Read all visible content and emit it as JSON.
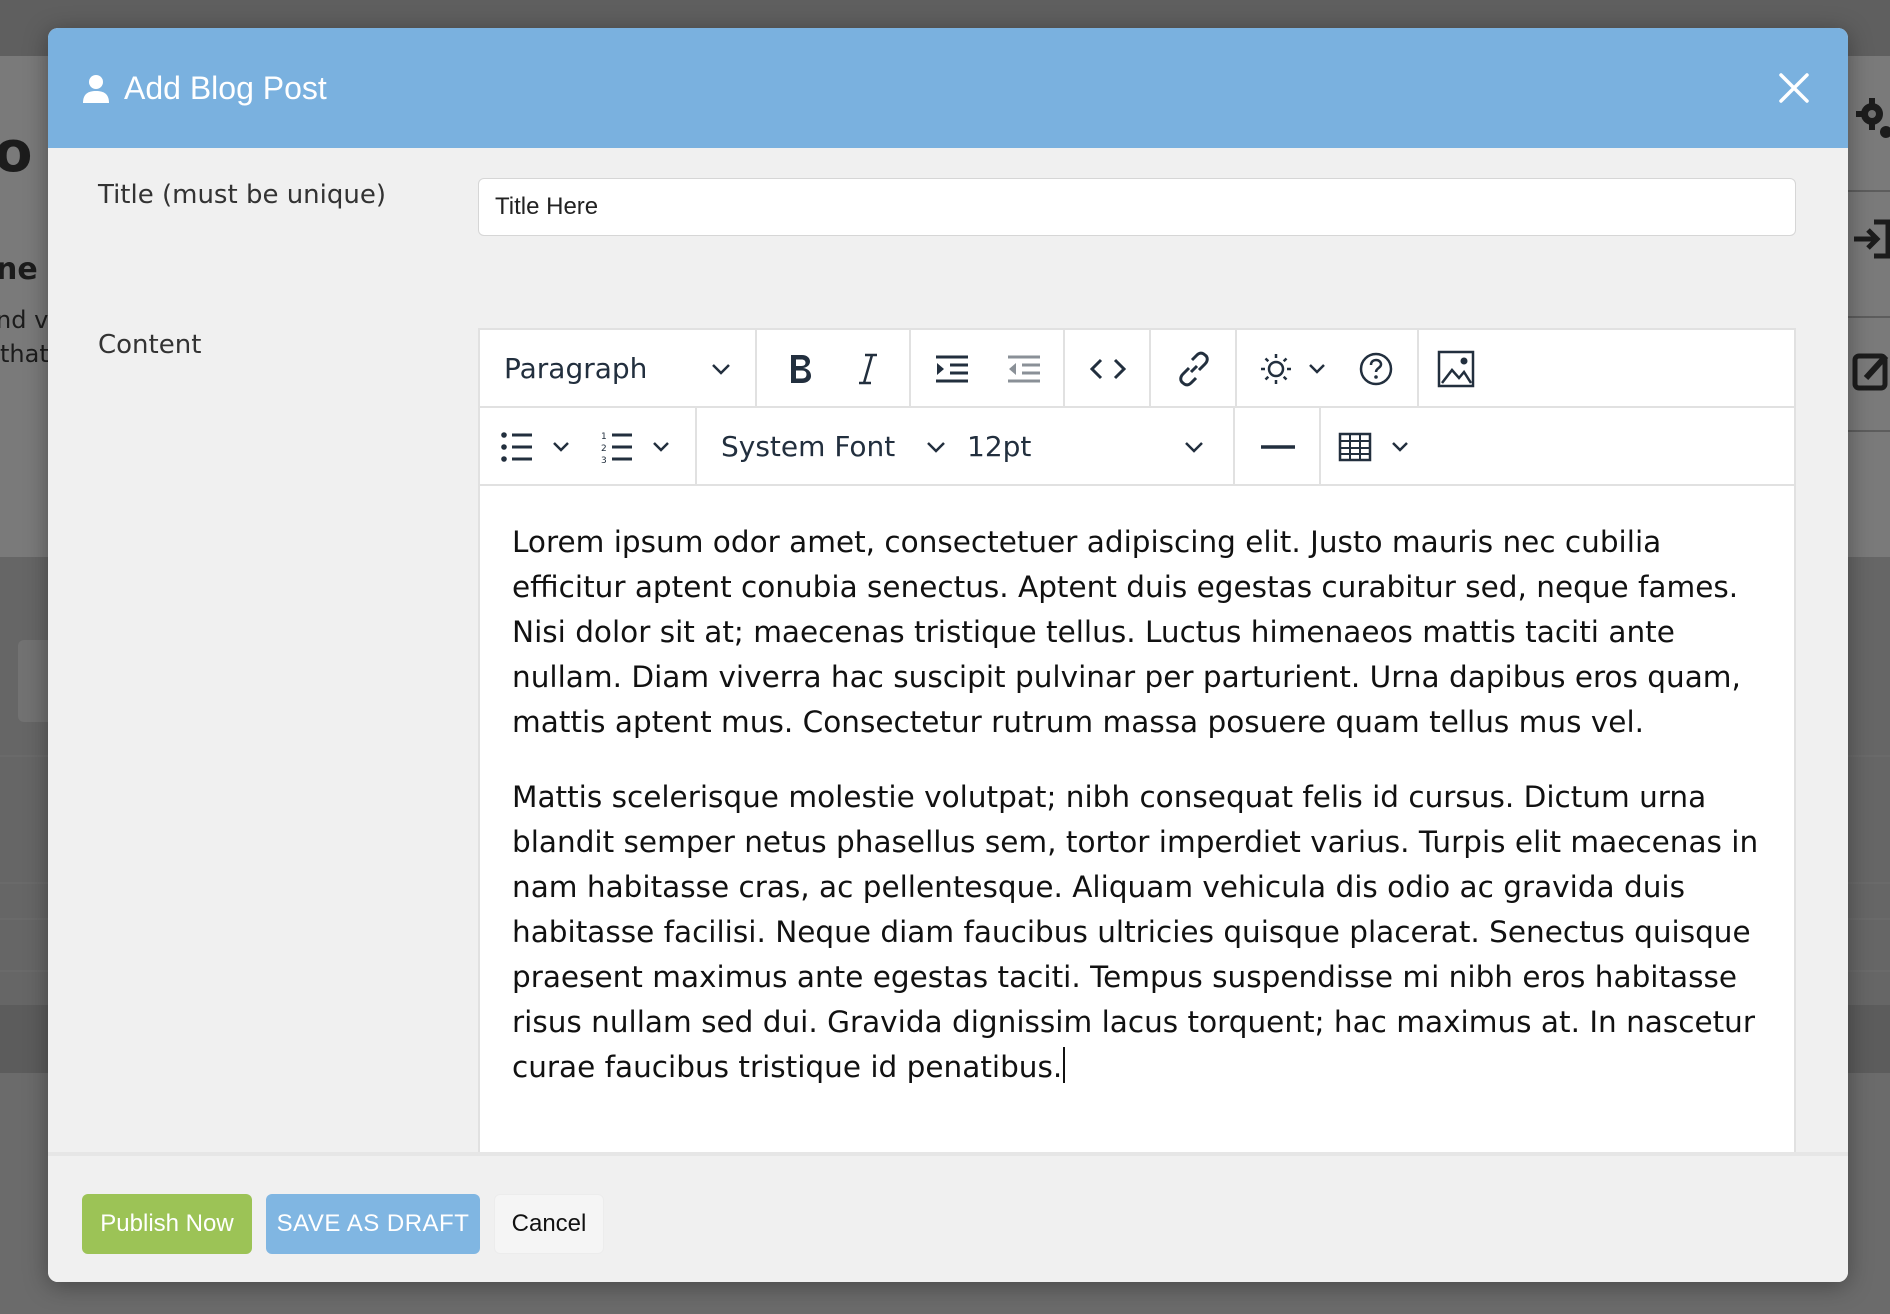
{
  "background": {
    "heading_fragment": "o &",
    "subheading_fragment": "ne",
    "line1_fragment": "nd v",
    "line2_fragment": "that"
  },
  "modal": {
    "title": "Add Blog Post",
    "header_icon": "user-icon",
    "close_icon": "close-icon",
    "header_color": "#7ab1df"
  },
  "form": {
    "title_label": "Title (must be unique)",
    "title_value": "Title Here",
    "content_label": "Content"
  },
  "toolbar": {
    "block_format": "Paragraph",
    "font_family": "System Font",
    "font_size": "12pt",
    "row1_icons": [
      "bold-icon",
      "italic-icon",
      "indent-icon",
      "outdent-icon",
      "code-icon",
      "link-icon",
      "theme-icon",
      "help-icon",
      "image-icon"
    ],
    "row2_icons": [
      "bullet-list-icon",
      "numbered-list-icon",
      "horizontal-rule-icon",
      "table-icon"
    ]
  },
  "content": {
    "paragraphs": [
      "Lorem ipsum odor amet, consectetuer adipiscing elit. Justo mauris nec cubilia efficitur aptent conubia senectus. Aptent duis egestas curabitur sed, neque fames. Nisi dolor sit at; maecenas tristique tellus. Luctus himenaeos mattis taciti ante nullam. Diam viverra hac suscipit pulvinar per parturient. Urna dapibus eros quam, mattis aptent mus. Consectetur rutrum massa posuere quam tellus mus vel.",
      "Mattis scelerisque molestie volutpat; nibh consequat felis id cursus. Dictum urna blandit semper netus phasellus sem, tortor imperdiet varius. Turpis elit maecenas in nam habitasse cras, ac pellentesque. Aliquam vehicula dis odio ac gravida duis habitasse facilisi. Neque diam faucibus ultricies quisque placerat. Senectus quisque praesent maximus ante egestas taciti. Tempus suspendisse mi nibh eros habitasse risus nullam sed dui. Gravida dignissim lacus torquent; hac maximus at. In nascetur curae faucibus tristique id penatibus."
    ]
  },
  "footer": {
    "publish_label": "Publish Now",
    "draft_label": "SAVE AS DRAFT",
    "cancel_label": "Cancel",
    "publish_color": "#9cc356",
    "draft_color": "#80b6e2"
  }
}
